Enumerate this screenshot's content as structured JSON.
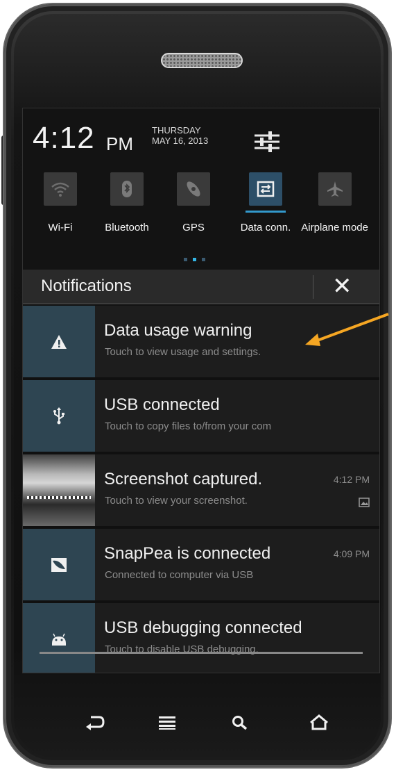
{
  "status": {
    "time": "4:12",
    "ampm": "PM",
    "day": "THURSDAY",
    "date": "MAY 16, 2013"
  },
  "quick_settings": [
    {
      "label": "Wi-Fi",
      "icon": "wifi-icon",
      "active": false
    },
    {
      "label": "Bluetooth",
      "icon": "bluetooth-icon",
      "active": false
    },
    {
      "label": "GPS",
      "icon": "gps-icon",
      "active": false
    },
    {
      "label": "Data conn.",
      "icon": "data-connection-icon",
      "active": true
    },
    {
      "label": "Airplane mode",
      "icon": "airplane-icon",
      "active": false
    }
  ],
  "notifications_header": {
    "title": "Notifications",
    "close_glyph": "✕"
  },
  "notifications": [
    {
      "title": "Data usage warning",
      "subtitle": "Touch to view usage and settings.",
      "icon": "warning-icon",
      "time": ""
    },
    {
      "title": "USB connected",
      "subtitle": "Touch to copy files to/from your com",
      "icon": "usb-icon",
      "time": ""
    },
    {
      "title": "Screenshot captured.",
      "subtitle": "Touch to view your screenshot.",
      "icon": "screenshot-thumbnail",
      "time": "4:12 PM"
    },
    {
      "title": "SnapPea is connected",
      "subtitle": "Connected to computer via USB",
      "icon": "snappea-icon",
      "time": "4:09 PM"
    },
    {
      "title": "USB debugging connected",
      "subtitle": "Touch to disable USB debugging.",
      "icon": "android-debug-icon",
      "time": ""
    }
  ],
  "colors": {
    "accent": "#33b5e5",
    "annotation_arrow": "#f5a623"
  }
}
